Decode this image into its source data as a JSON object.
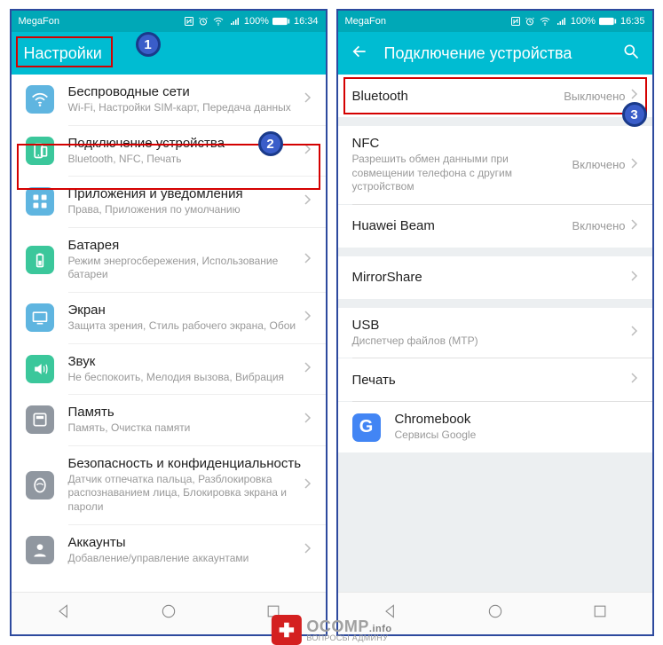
{
  "left": {
    "statusbar": {
      "carrier": "MegaFon",
      "battery": "100%",
      "time": "16:34"
    },
    "appbar": {
      "title": "Настройки"
    },
    "items": [
      {
        "icon": "wifi",
        "color": "#5fb5e0",
        "title": "Беспроводные сети",
        "sub": "Wi-Fi, Настройки SIM-карт, Передача данных"
      },
      {
        "icon": "device",
        "color": "#3bc79b",
        "title": "Подключение устройства",
        "sub": "Bluetooth, NFC, Печать"
      },
      {
        "icon": "apps",
        "color": "#5fb5e0",
        "title": "Приложения и уведомления",
        "sub": "Права, Приложения по умолчанию"
      },
      {
        "icon": "battery",
        "color": "#3bc79b",
        "title": "Батарея",
        "sub": "Режим энергосбережения, Использование батареи"
      },
      {
        "icon": "display",
        "color": "#5fb5e0",
        "title": "Экран",
        "sub": "Защита зрения, Стиль рабочего экрана, Обои"
      },
      {
        "icon": "sound",
        "color": "#3bc79b",
        "title": "Звук",
        "sub": "Не беспокоить, Мелодия вызова, Вибрация"
      },
      {
        "icon": "storage",
        "color": "#9097a0",
        "title": "Память",
        "sub": "Память, Очистка памяти"
      },
      {
        "icon": "security",
        "color": "#9097a0",
        "title": "Безопасность и конфиденциальность",
        "sub": "Датчик отпечатка пальца, Разблокировка распознаванием лица, Блокировка экрана и пароли"
      },
      {
        "icon": "accounts",
        "color": "#9097a0",
        "title": "Аккаунты",
        "sub": "Добавление/управление аккаунтами"
      }
    ]
  },
  "right": {
    "statusbar": {
      "carrier": "MegaFon",
      "battery": "100%",
      "time": "16:35"
    },
    "appbar": {
      "title": "Подключение устройства"
    },
    "items": [
      {
        "title": "Bluetooth",
        "value": "Выключено"
      },
      {
        "title": "NFC",
        "sub": "Разрешить обмен данными при совмещении телефона с другим устройством",
        "value": "Включено"
      },
      {
        "title": "Huawei Beam",
        "value": "Включено"
      },
      {
        "title": "MirrorShare"
      },
      {
        "title": "USB",
        "sub": "Диспетчер файлов (MTP)"
      },
      {
        "title": "Печать"
      },
      {
        "title": "Chromebook",
        "sub": "Сервисы Google",
        "hasIcon": true
      }
    ]
  },
  "annotations": {
    "b1": "1",
    "b2": "2",
    "b3": "3"
  },
  "watermark": {
    "brand": "OCOMP",
    "tld": ".info",
    "tag": "ВОПРОСЫ АДМИНУ"
  }
}
